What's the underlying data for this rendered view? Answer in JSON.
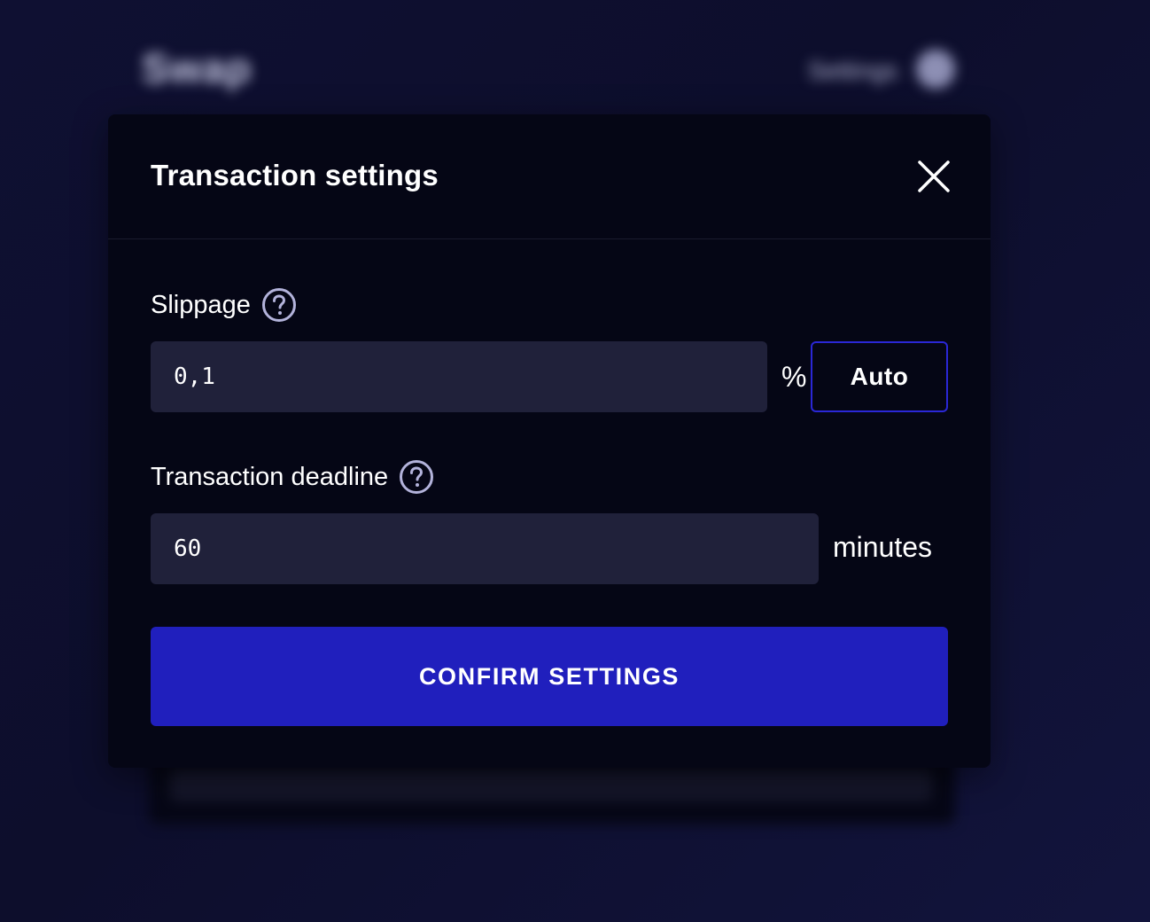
{
  "background": {
    "page_title": "Swap",
    "settings_label": "Settings"
  },
  "modal": {
    "title": "Transaction settings",
    "slippage": {
      "label": "Slippage",
      "value": "0,1",
      "unit": "%",
      "auto_label": "Auto"
    },
    "deadline": {
      "label": "Transaction deadline",
      "value": "60",
      "unit": "minutes"
    },
    "confirm_label": "CONFIRM SETTINGS"
  },
  "colors": {
    "accent": "#201fbd",
    "auto_border": "#2a27d6",
    "input_bg": "#20213a",
    "modal_bg": "#050615"
  },
  "icons": {
    "close": "close-icon",
    "help": "question-circle-icon",
    "settings": "gear-icon"
  }
}
